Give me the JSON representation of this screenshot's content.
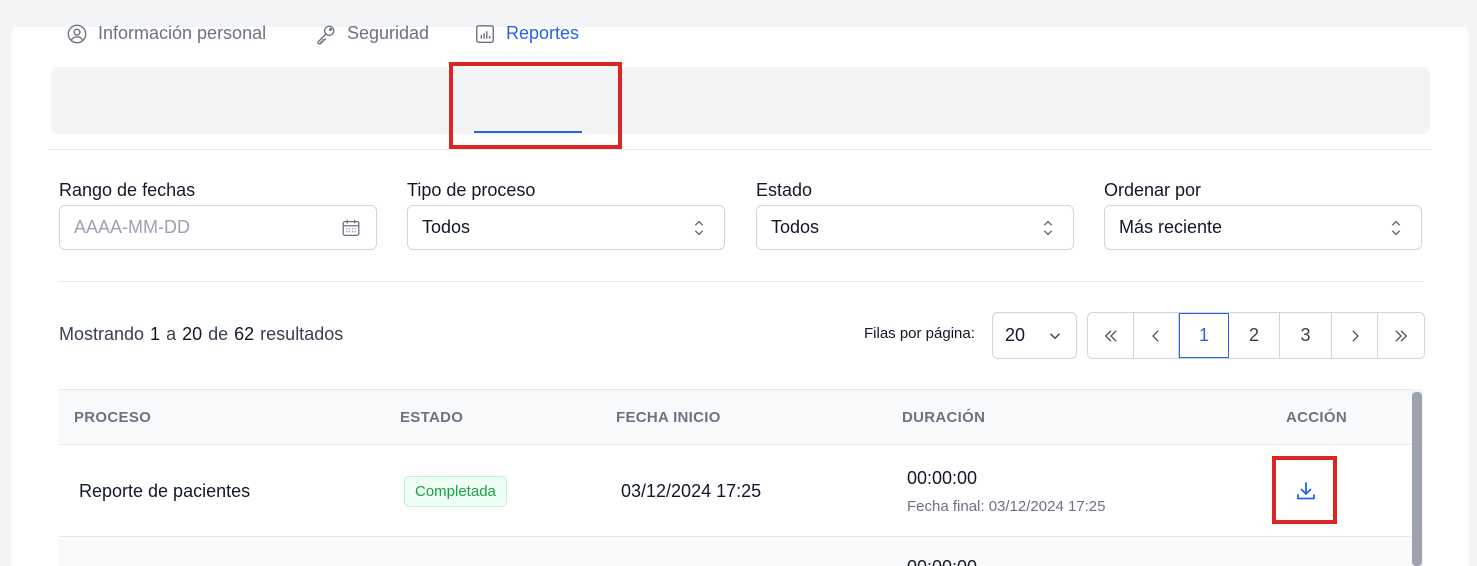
{
  "tabs": [
    {
      "label": "Información personal",
      "icon": "user-circle-icon",
      "active": false
    },
    {
      "label": "Seguridad",
      "icon": "key-icon",
      "active": false
    },
    {
      "label": "Reportes",
      "icon": "bar-chart-icon",
      "active": true
    }
  ],
  "filters": {
    "date_range": {
      "label": "Rango de fechas",
      "placeholder": "AAAA-MM-DD",
      "icon": "calendar-icon"
    },
    "process_type": {
      "label": "Tipo de proceso",
      "value": "Todos"
    },
    "status": {
      "label": "Estado",
      "value": "Todos"
    },
    "sort_by": {
      "label": "Ordenar por",
      "value": "Más reciente"
    }
  },
  "summary": {
    "prefix": "Mostrando",
    "from": "1",
    "to_word": "a",
    "to": "20",
    "of_word": "de",
    "total": "62",
    "suffix": "resultados"
  },
  "rows_per_page": {
    "label": "Filas por página:",
    "value": "20"
  },
  "pagination": {
    "pages": [
      "1",
      "2",
      "3"
    ],
    "current": "1"
  },
  "table": {
    "headers": {
      "process": "PROCESO",
      "status": "ESTADO",
      "start_date": "FECHA INICIO",
      "duration": "DURACIÓN",
      "action": "ACCIÓN"
    },
    "rows": [
      {
        "process": "Reporte de pacientes",
        "status": "Completada",
        "start_date": "03/12/2024 17:25",
        "duration": "00:00:00",
        "end_date": "Fecha final: 03/12/2024 17:25",
        "action_icon": "download-icon"
      },
      {
        "duration": "00:00:00"
      }
    ]
  },
  "colors": {
    "accent": "#2563eb",
    "success": "#16a34a",
    "highlight": "#dc2626"
  }
}
